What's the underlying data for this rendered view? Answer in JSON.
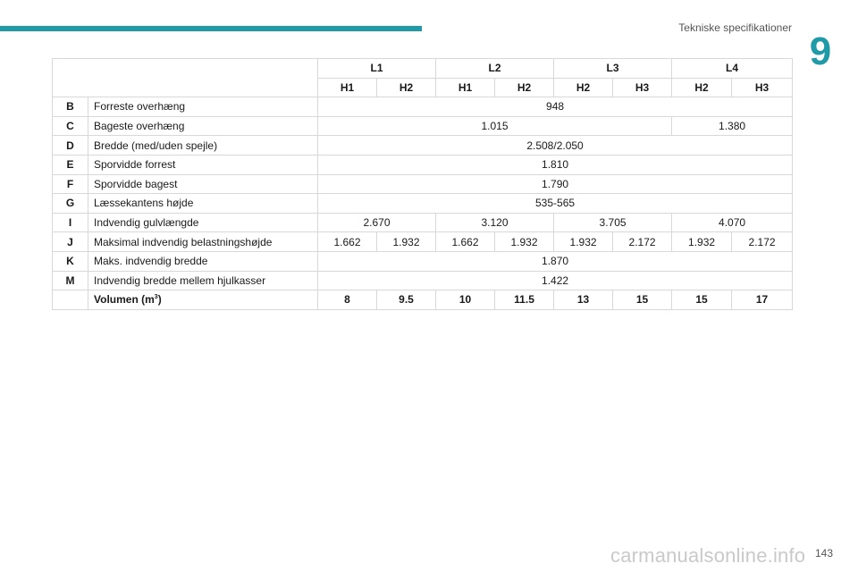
{
  "header": {
    "section_title": "Tekniske specifikationer",
    "chapter_number": "9"
  },
  "table": {
    "lengths": [
      "L1",
      "L2",
      "L3",
      "L4"
    ],
    "heights": [
      "H1",
      "H2",
      "H1",
      "H2",
      "H2",
      "H3",
      "H2",
      "H3"
    ],
    "rows": [
      {
        "code": "B",
        "desc": "Forreste overhæng",
        "values": [
          "948"
        ],
        "spans": [
          8
        ]
      },
      {
        "code": "C",
        "desc": "Bageste overhæng",
        "values": [
          "1.015",
          "1.380"
        ],
        "spans": [
          6,
          2
        ]
      },
      {
        "code": "D",
        "desc": "Bredde (med/uden spejle)",
        "values": [
          "2.508/2.050"
        ],
        "spans": [
          8
        ]
      },
      {
        "code": "E",
        "desc": "Sporvidde forrest",
        "values": [
          "1.810"
        ],
        "spans": [
          8
        ]
      },
      {
        "code": "F",
        "desc": "Sporvidde bagest",
        "values": [
          "1.790"
        ],
        "spans": [
          8
        ]
      },
      {
        "code": "G",
        "desc": "Læssekantens højde",
        "values": [
          "535-565"
        ],
        "spans": [
          8
        ]
      },
      {
        "code": "I",
        "desc": "Indvendig gulvlængde",
        "values": [
          "2.670",
          "3.120",
          "3.705",
          "4.070"
        ],
        "spans": [
          2,
          2,
          2,
          2
        ]
      },
      {
        "code": "J",
        "desc": "Maksimal indvendig belastningshøjde",
        "values": [
          "1.662",
          "1.932",
          "1.662",
          "1.932",
          "1.932",
          "2.172",
          "1.932",
          "2.172"
        ],
        "spans": [
          1,
          1,
          1,
          1,
          1,
          1,
          1,
          1
        ]
      },
      {
        "code": "K",
        "desc": "Maks. indvendig bredde",
        "values": [
          "1.870"
        ],
        "spans": [
          8
        ]
      },
      {
        "code": "M",
        "desc": "Indvendig bredde mellem hjulkasser",
        "values": [
          "1.422"
        ],
        "spans": [
          8
        ]
      }
    ],
    "volume": {
      "label": "Volumen (m",
      "unit_sup": "3",
      "label_close": ")",
      "values": [
        "8",
        "9.5",
        "10",
        "11.5",
        "13",
        "15",
        "15",
        "17"
      ]
    }
  },
  "footer": {
    "page_number": "143",
    "watermark": "carmanualsonline.info"
  }
}
